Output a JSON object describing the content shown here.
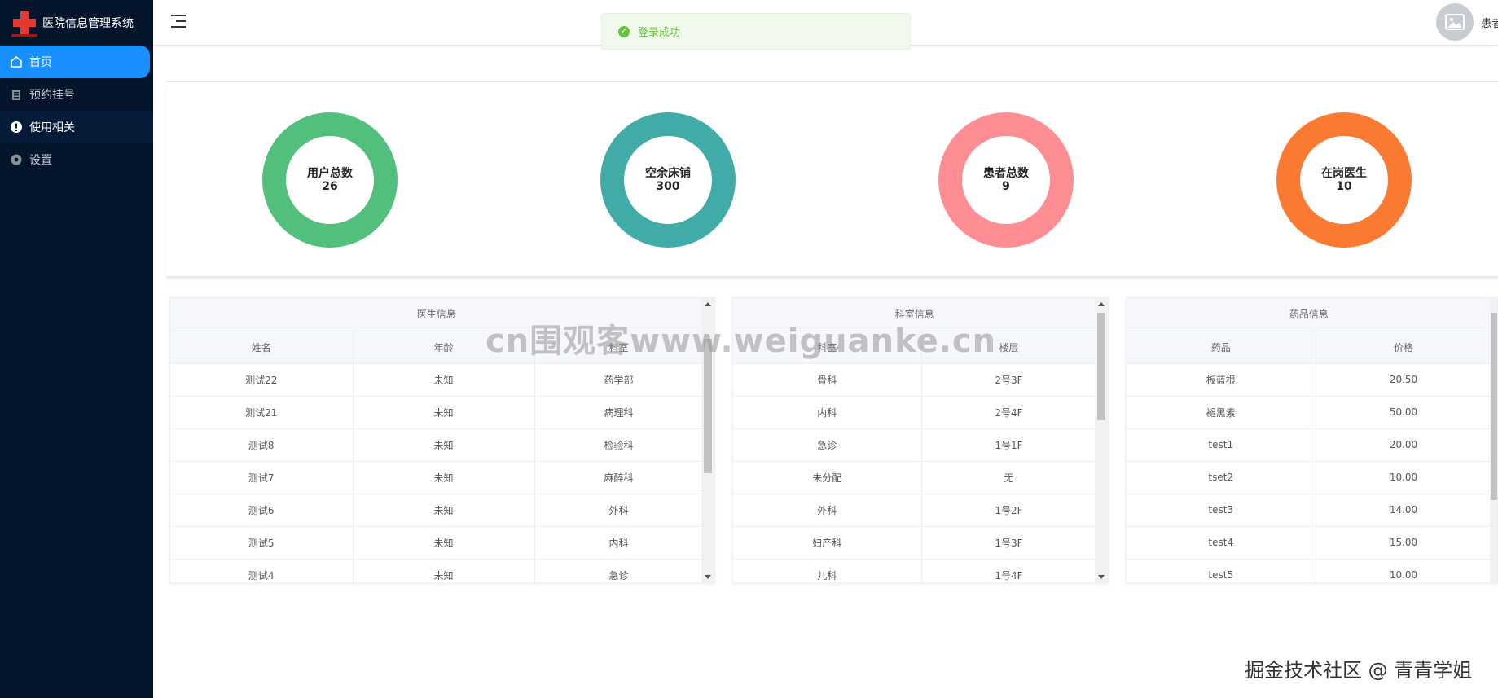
{
  "app": {
    "title": "医院信息管理系统"
  },
  "sidebar": {
    "items": [
      {
        "label": "首页",
        "icon": "home-icon",
        "active": true
      },
      {
        "label": "预约挂号",
        "icon": "clipboard-icon"
      },
      {
        "label": "使用相关",
        "icon": "info-icon"
      },
      {
        "label": "设置",
        "icon": "gear-icon"
      }
    ]
  },
  "header": {
    "user": "患者"
  },
  "toast": {
    "message": "登录成功"
  },
  "stats": [
    {
      "label": "用户总数",
      "value": "26",
      "color": "#52c07c"
    },
    {
      "label": "空余床铺",
      "value": "300",
      "color": "#41aba7"
    },
    {
      "label": "患者总数",
      "value": "9",
      "color": "#fe8d94"
    },
    {
      "label": "在岗医生",
      "value": "10",
      "color": "#f97a30"
    }
  ],
  "doctor_table": {
    "title": "医生信息",
    "columns": [
      "姓名",
      "年龄",
      "科室"
    ],
    "rows": [
      [
        "测试22",
        "未知",
        "药学部"
      ],
      [
        "测试21",
        "未知",
        "病理科"
      ],
      [
        "测试8",
        "未知",
        "检验科"
      ],
      [
        "测试7",
        "未知",
        "麻醉科"
      ],
      [
        "测试6",
        "未知",
        "外科"
      ],
      [
        "测试5",
        "未知",
        "内科"
      ],
      [
        "测试4",
        "未知",
        "急诊"
      ]
    ]
  },
  "dept_table": {
    "title": "科室信息",
    "columns": [
      "科室",
      "楼层"
    ],
    "rows": [
      [
        "骨科",
        "2号3F"
      ],
      [
        "内科",
        "2号4F"
      ],
      [
        "急诊",
        "1号1F"
      ],
      [
        "未分配",
        "无"
      ],
      [
        "外科",
        "1号2F"
      ],
      [
        "妇产科",
        "1号3F"
      ],
      [
        "儿科",
        "1号4F"
      ]
    ]
  },
  "drug_table": {
    "title": "药品信息",
    "columns": [
      "药品",
      "价格"
    ],
    "rows": [
      [
        "板蓝根",
        "20.50"
      ],
      [
        "褪黑素",
        "50.00"
      ],
      [
        "test1",
        "20.00"
      ],
      [
        "tset2",
        "10.00"
      ],
      [
        "test3",
        "14.00"
      ],
      [
        "test4",
        "15.00"
      ],
      [
        "test5",
        "10.00"
      ]
    ]
  },
  "overlay": {
    "watermark": "cn围观客www.weiguanke.cn",
    "credit": "掘金技术社区 @ 青青学姐"
  }
}
